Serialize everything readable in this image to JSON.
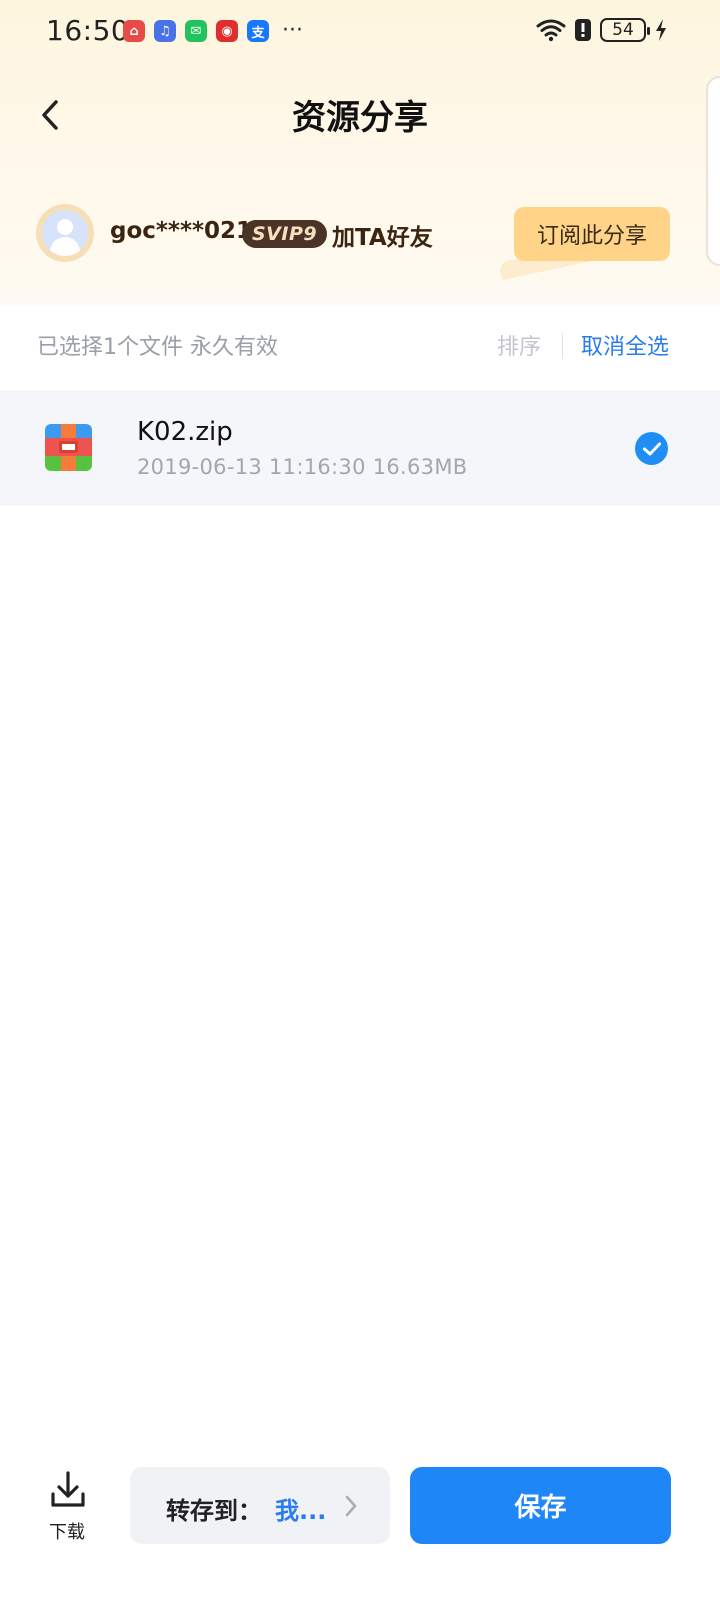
{
  "status_bar": {
    "time": "16:50",
    "notification_icons": [
      {
        "name": "app-red-icon",
        "color": "#e84a4a",
        "glyph": "⌂"
      },
      {
        "name": "music-icon",
        "color": "#4a72e8",
        "glyph": "♫"
      },
      {
        "name": "wechat-icon",
        "color": "#22c35e",
        "glyph": "✉"
      },
      {
        "name": "app-red2-icon",
        "color": "#e02d2d",
        "glyph": "◉"
      },
      {
        "name": "alipay-icon",
        "color": "#1677ff",
        "glyph": "支"
      }
    ],
    "more": "···",
    "battery": "54"
  },
  "header": {
    "title": "资源分享"
  },
  "sharer": {
    "name": "goc****021",
    "vip_badge": "SVIP9",
    "add_friend": "加TA好友",
    "subscribe_label": "订阅此分享"
  },
  "selection": {
    "info": "已选择1个文件 永久有效",
    "sort_label": "排序",
    "deselect_label": "取消全选"
  },
  "files": [
    {
      "name": "K02.zip",
      "meta": "2019-06-13  11:16:30   16.63MB",
      "selected": true
    }
  ],
  "bottom": {
    "download_label": "下载",
    "transfer_label": "转存到：",
    "transfer_target": "我...",
    "save_label": "保存"
  },
  "colors": {
    "accent_blue": "#1f86f7",
    "subscribe_bg": "#ffd489",
    "vip_bg": "#4a3428"
  }
}
